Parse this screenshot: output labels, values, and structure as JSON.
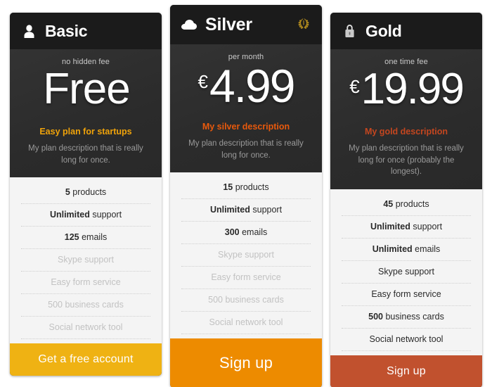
{
  "plans": [
    {
      "id": "basic",
      "name": "Basic",
      "icon": "user-icon",
      "featured": false,
      "badge": null,
      "fee_label": "no hidden fee",
      "currency": "",
      "price": "Free",
      "tagline": "Easy plan for startups",
      "description": "My plan description that is really long for once.",
      "features": [
        {
          "strong": "5",
          "text": " products",
          "enabled": true
        },
        {
          "strong": "Unlimited",
          "text": " support",
          "enabled": true
        },
        {
          "strong": "125",
          "text": " emails",
          "enabled": true
        },
        {
          "strong": "",
          "text": "Skype support",
          "enabled": false
        },
        {
          "strong": "",
          "text": "Easy form service",
          "enabled": false
        },
        {
          "strong": "",
          "text": "500 business cards",
          "enabled": false
        },
        {
          "strong": "",
          "text": "Social network tool",
          "enabled": false
        }
      ],
      "cta_label": "Get a free account",
      "accent_color": "#f0a30a",
      "cta_color": "#efb213"
    },
    {
      "id": "silver",
      "name": "Silver",
      "icon": "cloud-icon",
      "featured": true,
      "badge": "laurel-wreath-icon",
      "fee_label": "per month",
      "currency": "€",
      "price": "4.99",
      "tagline": "My silver description",
      "description": "My plan description that is really long for once.",
      "features": [
        {
          "strong": "15",
          "text": " products",
          "enabled": true
        },
        {
          "strong": "Unlimited",
          "text": " support",
          "enabled": true
        },
        {
          "strong": "300",
          "text": " emails",
          "enabled": true
        },
        {
          "strong": "",
          "text": "Skype support",
          "enabled": false
        },
        {
          "strong": "",
          "text": "Easy form service",
          "enabled": false
        },
        {
          "strong": "",
          "text": "500 business cards",
          "enabled": false
        },
        {
          "strong": "",
          "text": "Social network tool",
          "enabled": false
        }
      ],
      "cta_label": "Sign up",
      "accent_color": "#e8590c",
      "cta_color": "#ed8b00"
    },
    {
      "id": "gold",
      "name": "Gold",
      "icon": "lock-icon",
      "featured": false,
      "badge": null,
      "fee_label": "one time fee",
      "currency": "€",
      "price": "19.99",
      "tagline": "My gold description",
      "description": "My plan description that is really long for once (probably the longest).",
      "features": [
        {
          "strong": "45",
          "text": " products",
          "enabled": true
        },
        {
          "strong": "Unlimited",
          "text": " support",
          "enabled": true
        },
        {
          "strong": "Unlimited",
          "text": " emails",
          "enabled": true
        },
        {
          "strong": "",
          "text": "Skype support",
          "enabled": true
        },
        {
          "strong": "",
          "text": "Easy form service",
          "enabled": true
        },
        {
          "strong": "500",
          "text": " business cards",
          "enabled": true
        },
        {
          "strong": "",
          "text": "Social network tool",
          "enabled": true
        }
      ],
      "cta_label": "Sign up",
      "accent_color": "#c4461f",
      "cta_color": "#c1512e"
    }
  ]
}
